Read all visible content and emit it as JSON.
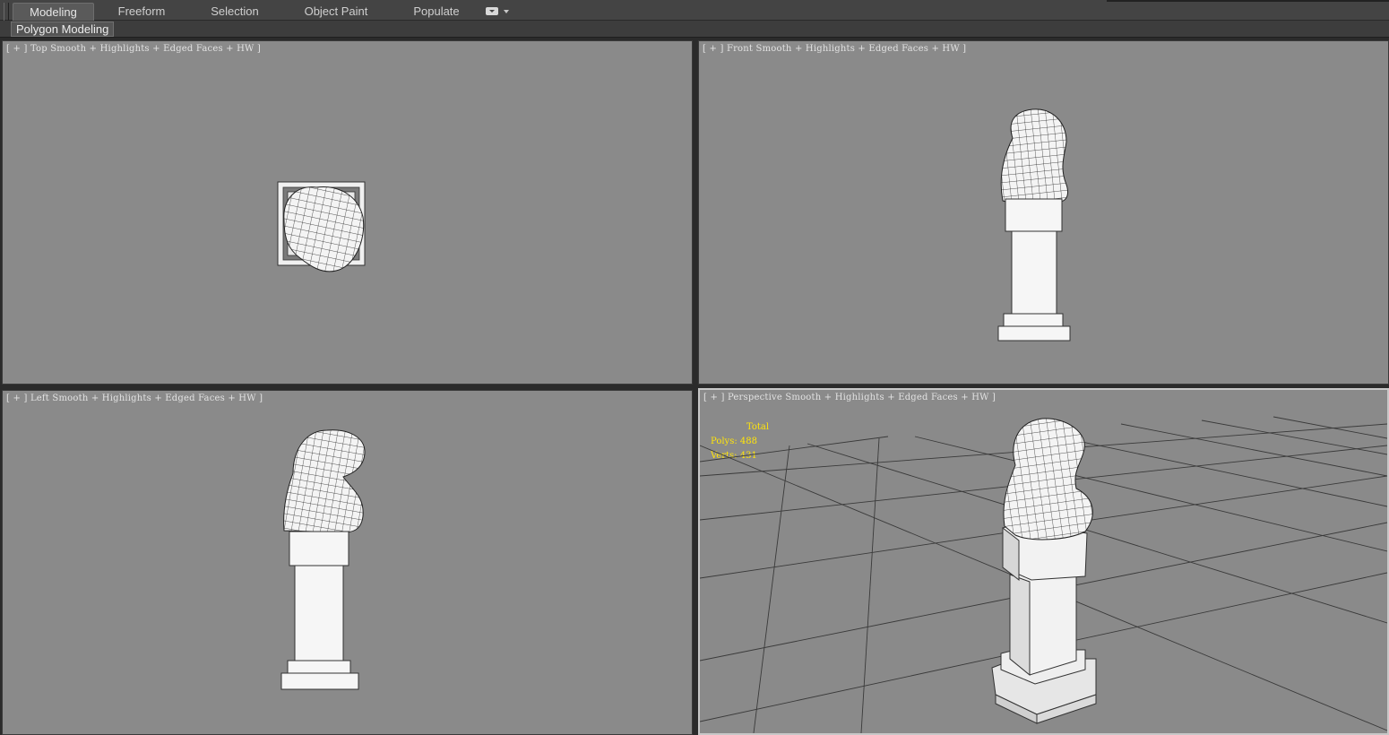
{
  "ribbon": {
    "tabs": [
      {
        "label": "Modeling",
        "active": true
      },
      {
        "label": "Freeform",
        "active": false
      },
      {
        "label": "Selection",
        "active": false
      },
      {
        "label": "Object Paint",
        "active": false
      },
      {
        "label": "Populate",
        "active": false
      }
    ],
    "more_icon": "dropdown-box-icon"
  },
  "subbar": {
    "panel_label": "Polygon Modeling"
  },
  "viewports": {
    "top": {
      "plus": "[ + ]",
      "name": "Top",
      "shading": "Smooth + Highlights + Edged Faces + HW ]"
    },
    "front": {
      "plus": "[ + ]",
      "name": "Front",
      "shading": "Smooth + Highlights + Edged Faces + HW ]"
    },
    "left": {
      "plus": "[ + ]",
      "name": "Left",
      "shading": "Smooth + Highlights + Edged Faces + HW ]"
    },
    "perspective": {
      "plus": "[ + ]",
      "name": "Perspective",
      "shading": "Smooth + Highlights + Edged Faces + HW ]",
      "stats": {
        "title": "Total",
        "polys_label": "Polys:",
        "polys": "488",
        "verts_label": "Verts:",
        "verts": "431"
      }
    }
  },
  "colors": {
    "viewport_bg": "#8a8a8a",
    "model_fill": "#f2f2f2",
    "stats_text": "#ffe40a",
    "active_border": "#c8c8c8"
  }
}
